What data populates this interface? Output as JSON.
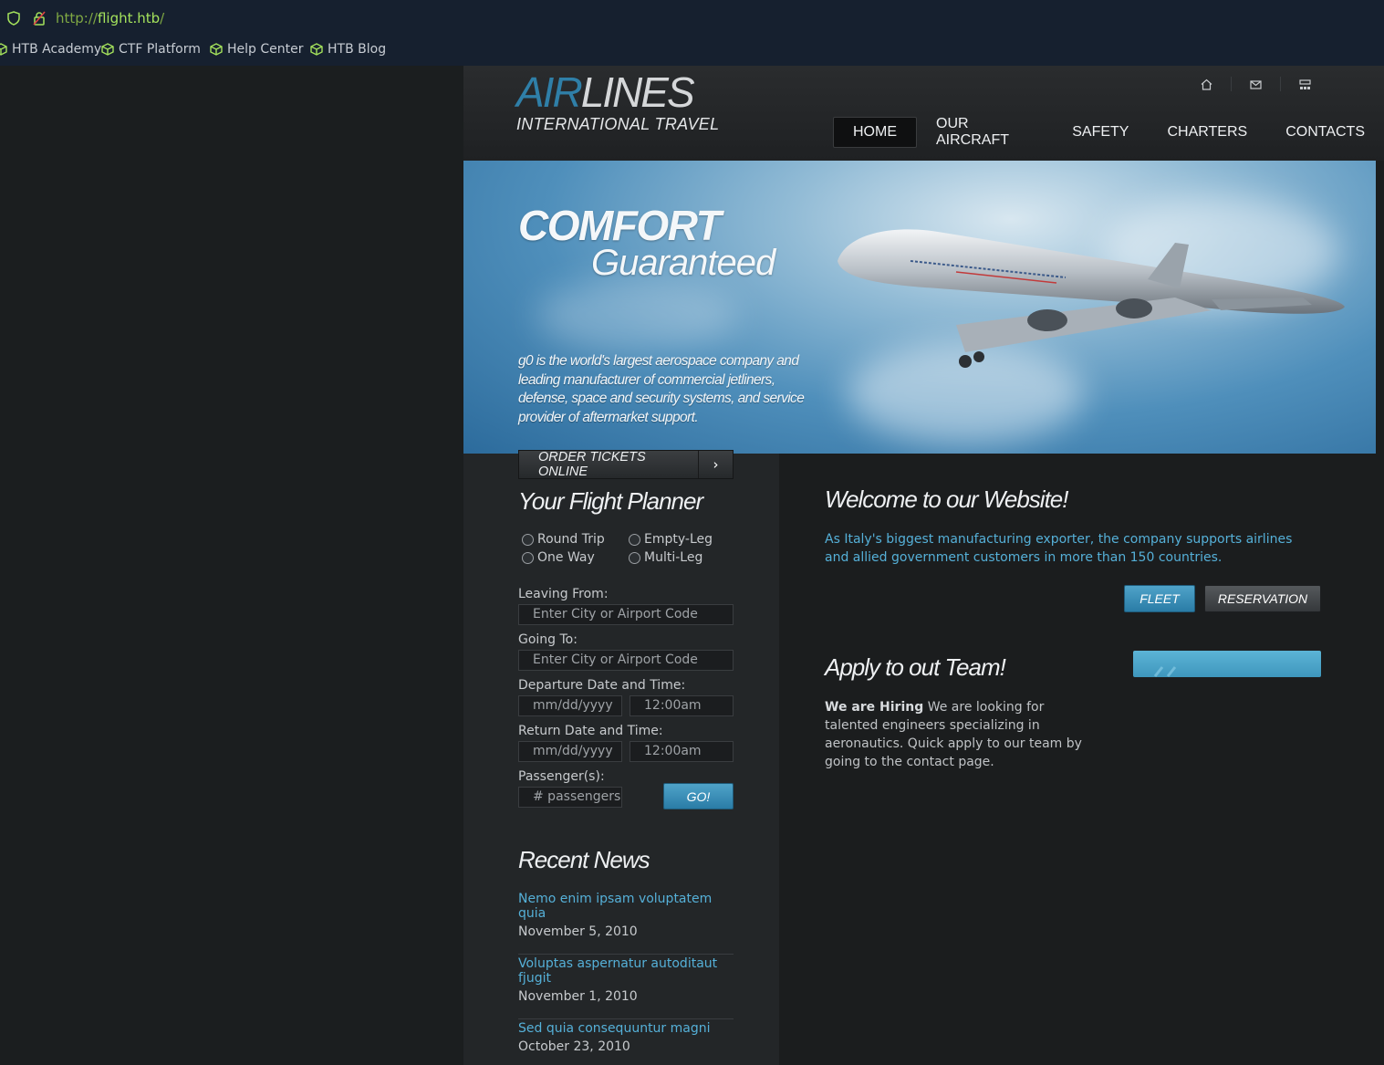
{
  "browser": {
    "url_scheme": "http://",
    "url_host": "flight.htb",
    "url_path": "/",
    "bookmarks": [
      {
        "label": "HTB Academy",
        "icon": "cube-icon"
      },
      {
        "label": "CTF Platform",
        "icon": "cube-icon"
      },
      {
        "label": "Help Center",
        "icon": "cube-icon"
      },
      {
        "label": "HTB Blog",
        "icon": "cube-icon"
      }
    ],
    "accent": "#a4e25c"
  },
  "header": {
    "logo_air": "AIR",
    "logo_lines": "LINES",
    "logo_sub": "INTERNATIONAL TRAVEL",
    "icons": [
      "home-icon",
      "mail-icon",
      "sitemap-icon"
    ],
    "nav": [
      "HOME",
      "OUR AIRCRAFT",
      "SAFETY",
      "CHARTERS",
      "CONTACTS"
    ],
    "active_nav": "HOME"
  },
  "hero": {
    "headline": "COMFORT",
    "subheadline": "Guaranteed",
    "blurb": "g0 is the world's largest aerospace company and leading manufacturer of commercial jetliners, defense, space and security systems, and service provider of aftermarket support."
  },
  "planner": {
    "order_label": "ORDER TICKETS ONLINE",
    "title": "Your Flight Planner",
    "trip_types": [
      "Round Trip",
      "Empty-Leg",
      "One Way",
      "Multi-Leg"
    ],
    "leaving_label": "Leaving From:",
    "leaving_placeholder": "Enter City or Airport Code",
    "going_label": "Going To:",
    "going_placeholder": "Enter City or Airport Code",
    "departure_label": "Departure Date and Time:",
    "departure_date": "mm/dd/yyyy",
    "departure_time": "12:00am",
    "return_label": "Return Date and Time:",
    "return_date": "mm/dd/yyyy",
    "return_time": "12:00am",
    "passengers_label": "Passenger(s):",
    "passengers_placeholder": "# passengers",
    "go_label": "GO!"
  },
  "news": {
    "title": "Recent News",
    "items": [
      {
        "title": "Nemo enim ipsam voluptatem quia",
        "date": "November 5, 2010"
      },
      {
        "title": "Voluptas aspernatur autoditaut fjugit",
        "date": "November 1, 2010"
      },
      {
        "title": "Sed quia consequuntur magni",
        "date": "October 23, 2010"
      }
    ]
  },
  "welcome": {
    "title": "Welcome to our Website!",
    "text": "As Italy's biggest manufacturing exporter, the company supports airlines and allied government customers in more than 150 countries.",
    "fleet_label": "FLEET",
    "reservation_label": "RESERVATION"
  },
  "apply": {
    "title": "Apply to out Team!",
    "lead": "We are Hiring",
    "text": " We are looking for talented engineers specializing in aeronautics. Quick apply to our team by going to the contact page."
  },
  "colors": {
    "link_blue": "#55b0d8",
    "button_blue": "#2a7ca6",
    "logo_blue": "#2f7fa8"
  }
}
